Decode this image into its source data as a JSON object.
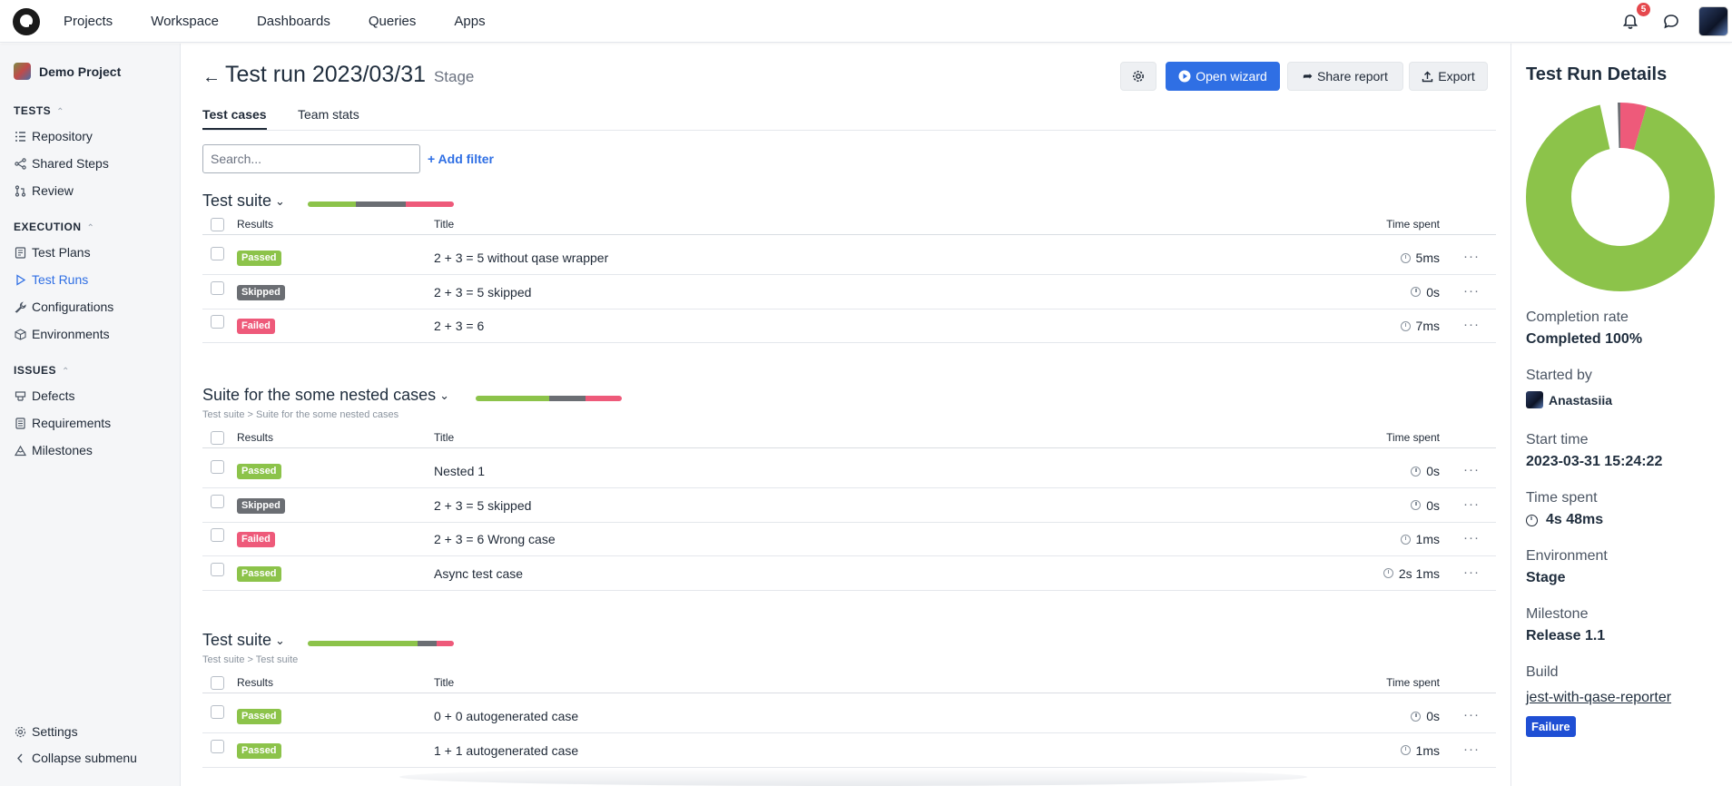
{
  "nav": {
    "links": [
      "Projects",
      "Workspace",
      "Dashboards",
      "Queries",
      "Apps"
    ],
    "notification_count": "5"
  },
  "sidebar": {
    "project": "Demo Project",
    "sections": [
      {
        "label": "TESTS",
        "items": [
          "Repository",
          "Shared Steps",
          "Review"
        ]
      },
      {
        "label": "EXECUTION",
        "items": [
          "Test Plans",
          "Test Runs",
          "Configurations",
          "Environments"
        ]
      },
      {
        "label": "ISSUES",
        "items": [
          "Defects",
          "Requirements",
          "Milestones"
        ]
      }
    ],
    "active_item": "Test Runs",
    "footer": {
      "settings": "Settings",
      "collapse": "Collapse submenu"
    }
  },
  "header": {
    "title": "Test run 2023/03/31",
    "environment": "Stage",
    "buttons": {
      "wizard": "Open wizard",
      "share": "Share report",
      "export": "Export"
    }
  },
  "tabs": [
    "Test cases",
    "Team stats"
  ],
  "active_tab": "Test cases",
  "search": {
    "placeholder": "Search..."
  },
  "add_filter": "+ Add filter",
  "table_headers": {
    "results": "Results",
    "title": "Title",
    "time": "Time spent"
  },
  "colors": {
    "passed": "#8cc34a",
    "skipped": "#6b6e73",
    "failed": "#ee5a7a",
    "accent": "#2f6fe4"
  },
  "suites": [
    {
      "name": "Test suite",
      "breadcrumb": "",
      "progress": {
        "passed": 0.33,
        "skipped": 0.34,
        "failed": 0.33
      },
      "rows": [
        {
          "status": "Passed",
          "title": "2 + 3 = 5 without qase wrapper",
          "time": "5ms"
        },
        {
          "status": "Skipped",
          "title": "2 + 3 = 5 skipped",
          "time": "0s"
        },
        {
          "status": "Failed",
          "title": "2 + 3 = 6",
          "time": "7ms"
        }
      ]
    },
    {
      "name": "Suite for the some nested cases",
      "breadcrumb": "Test suite > Suite for the some nested cases",
      "progress": {
        "passed": 0.5,
        "skipped": 0.25,
        "failed": 0.25
      },
      "rows": [
        {
          "status": "Passed",
          "title": "Nested 1",
          "time": "0s"
        },
        {
          "status": "Skipped",
          "title": "2 + 3 = 5 skipped",
          "time": "0s"
        },
        {
          "status": "Failed",
          "title": "2 + 3 = 6 Wrong case",
          "time": "1ms"
        },
        {
          "status": "Passed",
          "title": "Async test case",
          "time": "2s 1ms"
        }
      ]
    },
    {
      "name": "Test suite",
      "breadcrumb": "Test suite > Test suite",
      "progress": {
        "passed": 0.75,
        "skipped": 0.13,
        "failed": 0.12
      },
      "rows": [
        {
          "status": "Passed",
          "title": "0 + 0 autogenerated case",
          "time": "0s"
        },
        {
          "status": "Passed",
          "title": "1 + 1 autogenerated case",
          "time": "1ms"
        }
      ]
    }
  ],
  "details": {
    "title": "Test Run Details",
    "donut": {
      "passed": 0.92,
      "skipped": 0.03,
      "failed": 0.05
    },
    "completion_label": "Completion rate",
    "completion_value": "Completed 100%",
    "started_label": "Started by",
    "started_value": "Anastasiia",
    "start_time_label": "Start time",
    "start_time_value": "2023-03-31 15:24:22",
    "time_spent_label": "Time spent",
    "time_spent_value": "4s 48ms",
    "environment_label": "Environment",
    "environment_value": "Stage",
    "milestone_label": "Milestone",
    "milestone_value": "Release 1.1",
    "build_label": "Build",
    "build_value": "jest-with-qase-reporter",
    "build_status": "Failure"
  }
}
